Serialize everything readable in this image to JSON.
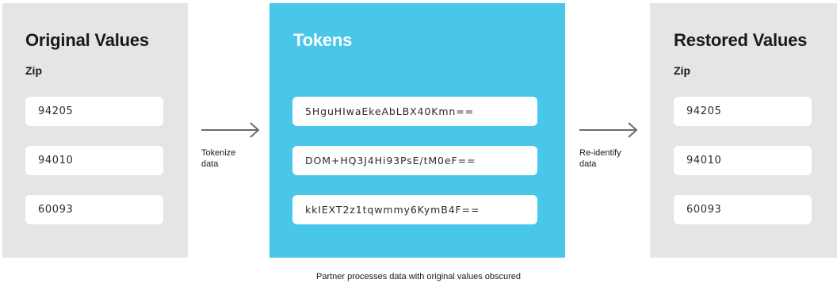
{
  "original": {
    "title": "Original Values",
    "subtitle": "Zip",
    "values": [
      "94205",
      "94010",
      "60093"
    ]
  },
  "tokens": {
    "title": "Tokens",
    "values": [
      "5HguHIwaEkeAbLBX40Kmn==",
      "DOM+HQ3J4Hi93PsE/tM0eF==",
      "kkIEXT2z1tqwmmy6KymB4F=="
    ]
  },
  "restored": {
    "title": "Restored Values",
    "subtitle": "Zip",
    "values": [
      "94205",
      "94010",
      "60093"
    ]
  },
  "arrows": {
    "tokenize": {
      "line1": "Tokenize",
      "line2": "data"
    },
    "reidentify": {
      "line1": "Re-identify",
      "line2": "data"
    }
  },
  "caption": "Partner processes data with original values obscured",
  "colors": {
    "panel_gray": "#e5e5e7",
    "token_blue": "#49c7e9",
    "arrow": "#6b6b6b"
  }
}
